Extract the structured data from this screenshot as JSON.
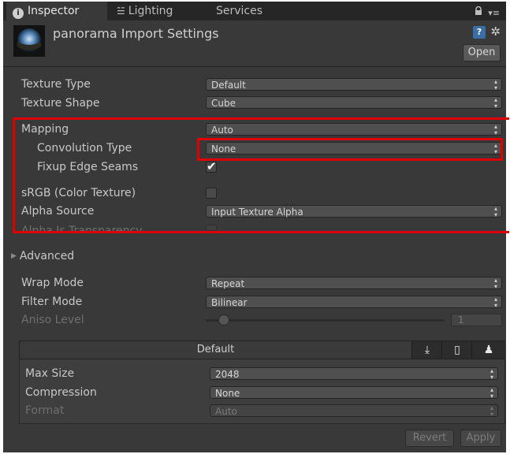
{
  "tabs": [
    {
      "label": "Inspector",
      "icon": "info-icon"
    },
    {
      "label": "Lighting",
      "icon": "lighting-icon"
    },
    {
      "label": "Services"
    }
  ],
  "header": {
    "title": "panorama Import Settings",
    "open_label": "Open"
  },
  "fields": {
    "texture_type": {
      "label": "Texture Type",
      "value": "Default"
    },
    "texture_shape": {
      "label": "Texture Shape",
      "value": "Cube"
    },
    "mapping": {
      "label": "Mapping",
      "value": "Auto"
    },
    "convolution_type": {
      "label": "Convolution Type",
      "value": "None"
    },
    "fixup_edge_seams": {
      "label": "Fixup Edge Seams",
      "checked": true
    },
    "srgb": {
      "label": "sRGB (Color Texture)",
      "checked": false
    },
    "alpha_source": {
      "label": "Alpha Source",
      "value": "Input Texture Alpha"
    },
    "alpha_is_transparency": {
      "label": "Alpha Is Transparency",
      "checked": false
    },
    "advanced": {
      "label": "Advanced"
    },
    "wrap_mode": {
      "label": "Wrap Mode",
      "value": "Repeat"
    },
    "filter_mode": {
      "label": "Filter Mode",
      "value": "Bilinear"
    },
    "aniso_level": {
      "label": "Aniso Level",
      "value": "1"
    }
  },
  "platform": {
    "default_label": "Default",
    "max_size": {
      "label": "Max Size",
      "value": "2048"
    },
    "compression": {
      "label": "Compression",
      "value": "None"
    },
    "format": {
      "label": "Format",
      "value": "Auto"
    }
  },
  "footer": {
    "revert_label": "Revert",
    "apply_label": "Apply"
  },
  "colors": {
    "panel_bg": "#393939",
    "highlight": "#e00000"
  }
}
